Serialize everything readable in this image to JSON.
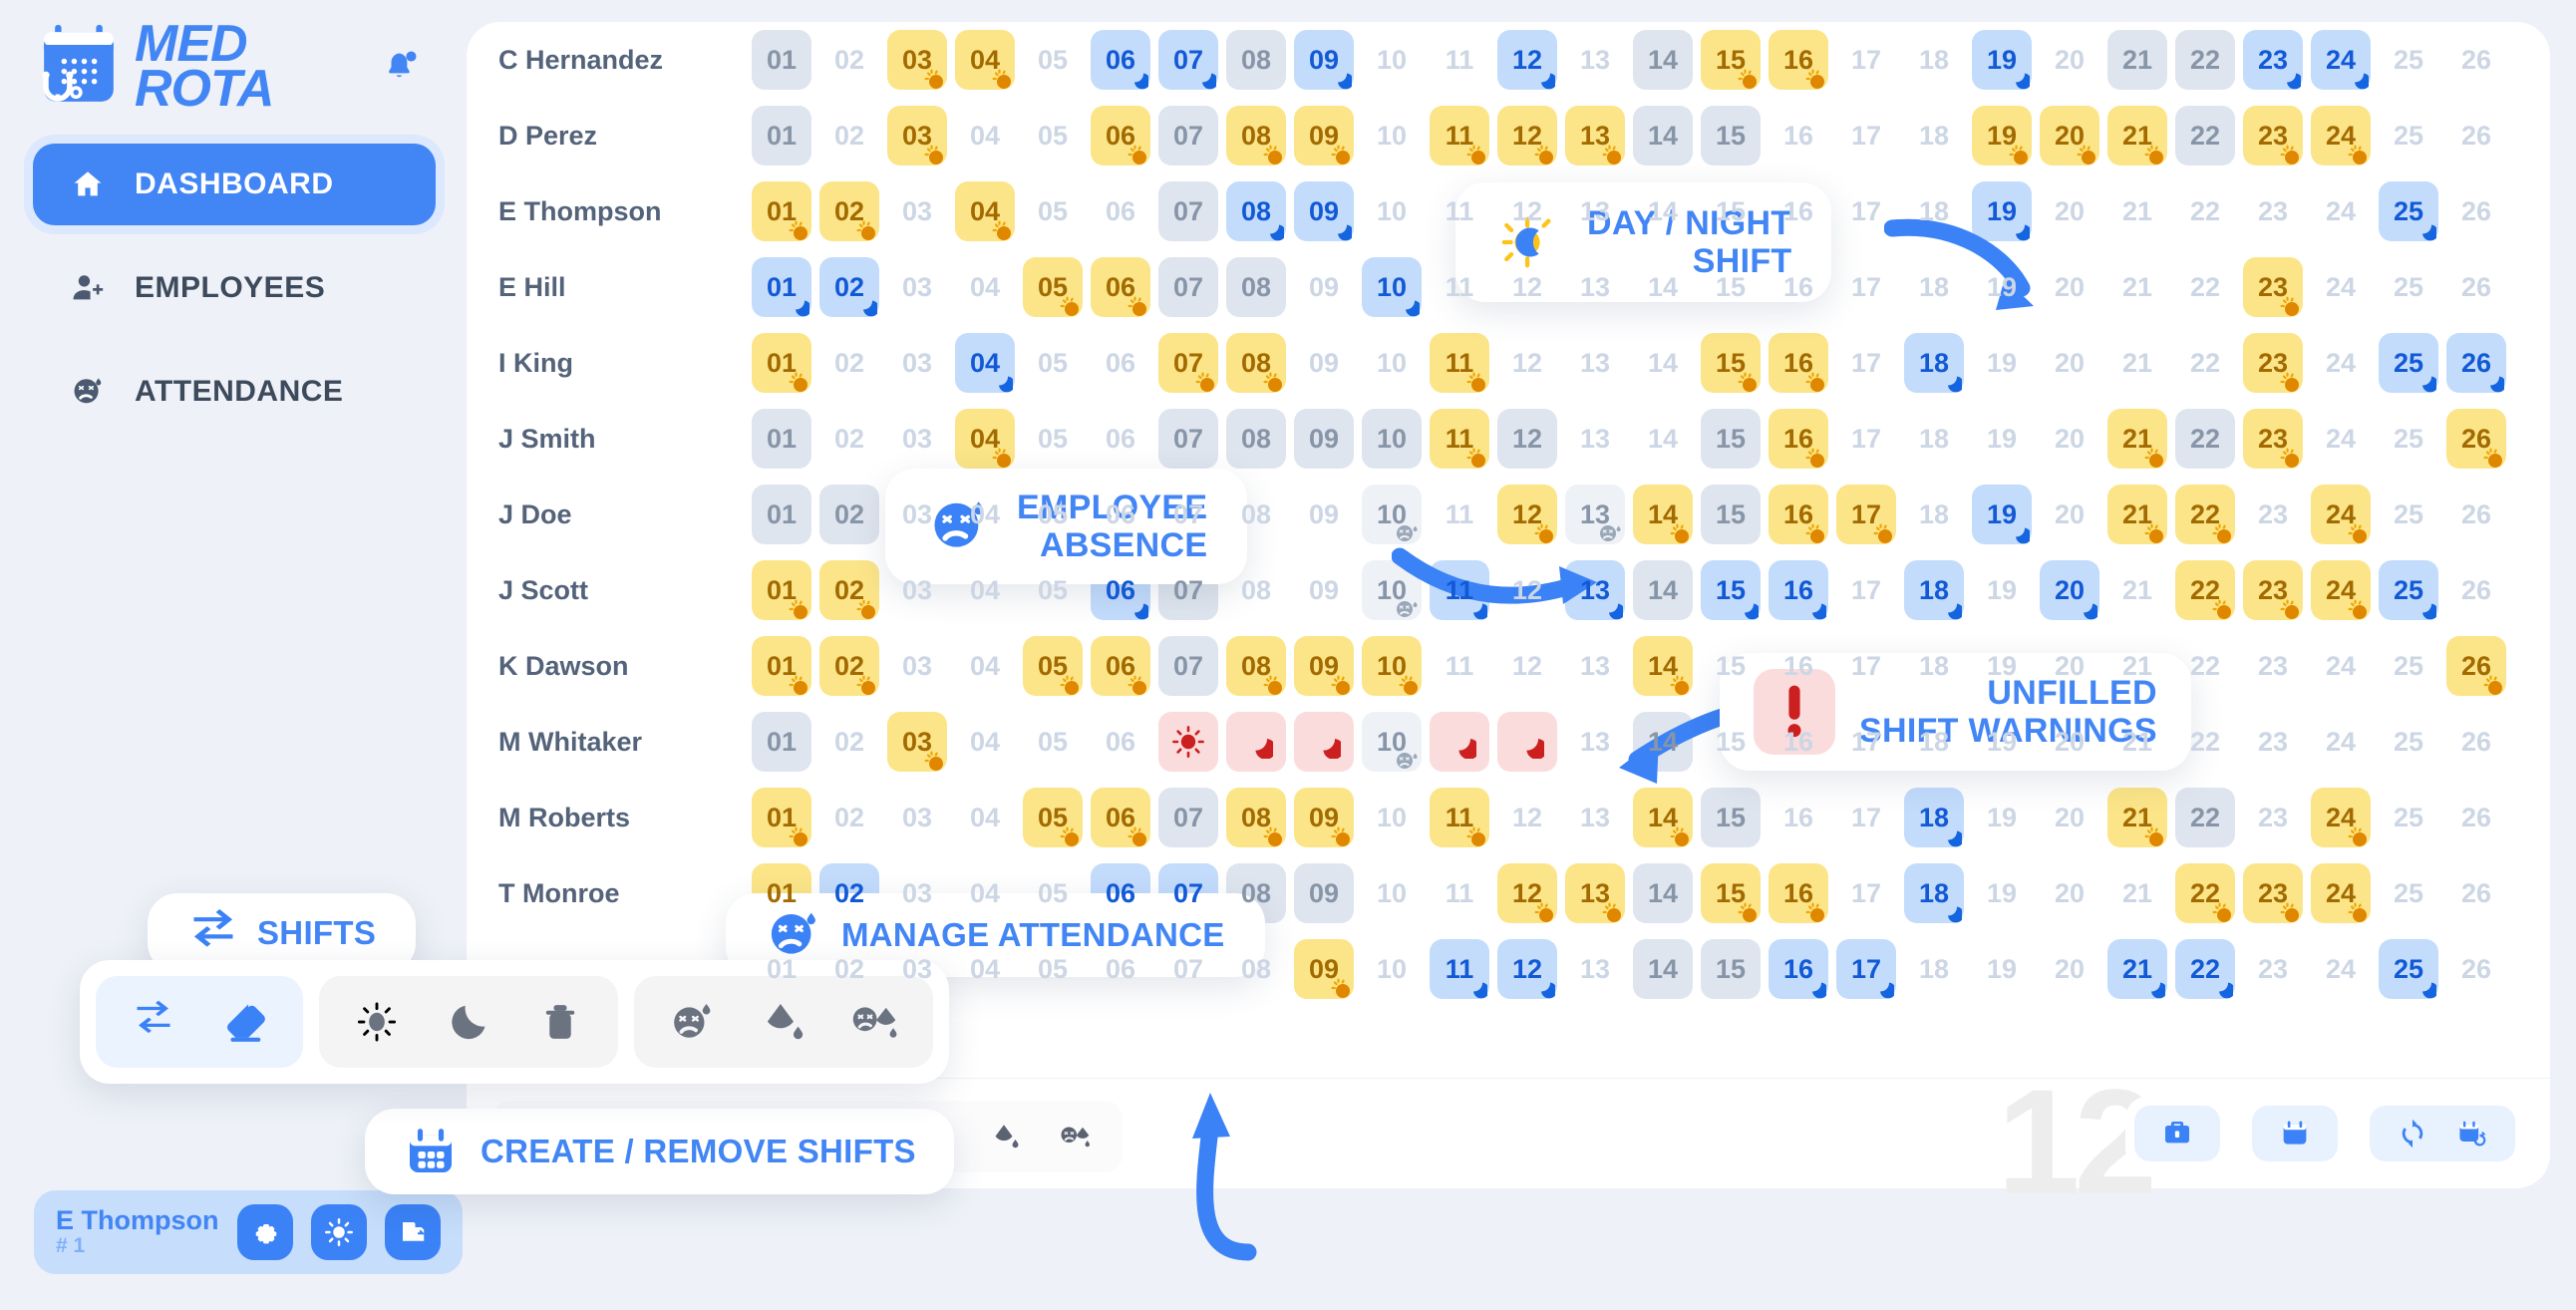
{
  "brand": {
    "line1": "MED",
    "line2": "ROTA",
    "logo_icon": "calendar-stethoscope-icon",
    "bell_icon": "bell-notification-icon",
    "accent": "#4285f4"
  },
  "sidebar": {
    "items": [
      {
        "label": "DASHBOARD",
        "icon": "home-icon",
        "active": true
      },
      {
        "label": "EMPLOYEES",
        "icon": "user-add-icon",
        "active": false
      },
      {
        "label": "ATTENDANCE",
        "icon": "sick-face-icon",
        "active": false
      }
    ]
  },
  "user_card": {
    "name": "E Thompson",
    "number": "# 1",
    "buttons": [
      {
        "icon": "gear-icon",
        "name": "settings"
      },
      {
        "icon": "sun-icon",
        "name": "day-shift"
      },
      {
        "icon": "save-icon",
        "name": "save"
      }
    ]
  },
  "schedule": {
    "days": [
      "01",
      "02",
      "03",
      "04",
      "05",
      "06",
      "07",
      "08",
      "09",
      "10",
      "11",
      "12",
      "13",
      "14",
      "15",
      "16",
      "17",
      "18",
      "19",
      "20",
      "21",
      "22",
      "23",
      "24",
      "25",
      "26"
    ],
    "legend": {
      "day": "#fce588",
      "night": "#c3dcfc",
      "gray": "#dfe5ee",
      "unfilled": "#fbdcdc",
      "absent": "#eef2f7"
    },
    "rows": [
      {
        "name": "C Hernandez",
        "cells": [
          "gray",
          "none",
          "day",
          "day",
          "none",
          "night",
          "night",
          "gray",
          "night",
          "none",
          "none",
          "night",
          "none",
          "gray",
          "day",
          "day",
          "none",
          "none",
          "night",
          "none",
          "gray",
          "gray",
          "night",
          "night",
          "none",
          "none"
        ]
      },
      {
        "name": "D Perez",
        "cells": [
          "gray",
          "none",
          "day",
          "none",
          "none",
          "day",
          "gray",
          "day",
          "day",
          "none",
          "day",
          "day",
          "day",
          "gray",
          "gray",
          "none",
          "none",
          "none",
          "day",
          "day",
          "day",
          "gray",
          "day",
          "day",
          "none",
          "none"
        ]
      },
      {
        "name": "E Thompson",
        "cells": [
          "day",
          "day",
          "none",
          "day",
          "none",
          "none",
          "gray",
          "night",
          "night",
          "none",
          "none",
          "none",
          "none",
          "none",
          "none",
          "none",
          "none",
          "none",
          "night",
          "none",
          "none",
          "none",
          "none",
          "none",
          "night",
          "none"
        ]
      },
      {
        "name": "E Hill",
        "cells": [
          "night",
          "night",
          "none",
          "none",
          "day",
          "day",
          "gray",
          "gray",
          "none",
          "night",
          "none",
          "none",
          "none",
          "none",
          "none",
          "none",
          "none",
          "none",
          "none",
          "none",
          "none",
          "none",
          "day",
          "none",
          "none",
          "none"
        ]
      },
      {
        "name": "I King",
        "cells": [
          "day",
          "none",
          "none",
          "night",
          "none",
          "none",
          "day",
          "day",
          "none",
          "none",
          "day",
          "none",
          "none",
          "none",
          "day",
          "day",
          "none",
          "night",
          "none",
          "none",
          "none",
          "none",
          "day",
          "none",
          "night",
          "night"
        ]
      },
      {
        "name": "J Smith",
        "cells": [
          "gray",
          "none",
          "none",
          "day",
          "none",
          "none",
          "gray",
          "gray",
          "gray",
          "gray",
          "day",
          "gray",
          "none",
          "none",
          "gray",
          "day",
          "none",
          "none",
          "none",
          "none",
          "day",
          "gray",
          "day",
          "none",
          "none",
          "day"
        ]
      },
      {
        "name": "J Doe",
        "cells": [
          "gray",
          "gray",
          "none",
          "none",
          "none",
          "none",
          "none",
          "none",
          "none",
          "absent",
          "none",
          "day",
          "absent",
          "day",
          "gray",
          "day",
          "day",
          "none",
          "night",
          "none",
          "day",
          "day",
          "none",
          "day",
          "none",
          "none"
        ]
      },
      {
        "name": "J Scott",
        "cells": [
          "day",
          "day",
          "none",
          "none",
          "none",
          "night",
          "gray",
          "none",
          "none",
          "absent",
          "night",
          "none",
          "night",
          "gray",
          "night",
          "night",
          "none",
          "night",
          "none",
          "night",
          "none",
          "day",
          "day",
          "day",
          "night",
          "none"
        ]
      },
      {
        "name": "K Dawson",
        "cells": [
          "day",
          "day",
          "none",
          "none",
          "day",
          "day",
          "gray",
          "day",
          "day",
          "day",
          "none",
          "none",
          "none",
          "day",
          "none",
          "none",
          "none",
          "none",
          "none",
          "none",
          "none",
          "none",
          "none",
          "none",
          "none",
          "day"
        ]
      },
      {
        "name": "M Whitaker",
        "cells": [
          "gray",
          "none",
          "day",
          "none",
          "none",
          "none",
          "unfilled-day",
          "unfilled-night",
          "unfilled-night",
          "absent",
          "unfilled-night",
          "unfilled-night",
          "none",
          "gray",
          "none",
          "none",
          "none",
          "none",
          "none",
          "none",
          "none",
          "none",
          "none",
          "none",
          "none",
          "none"
        ]
      },
      {
        "name": "M Roberts",
        "cells": [
          "day",
          "none",
          "none",
          "none",
          "day",
          "day",
          "gray",
          "day",
          "day",
          "none",
          "day",
          "none",
          "none",
          "day",
          "gray",
          "none",
          "none",
          "night",
          "none",
          "none",
          "day",
          "gray",
          "none",
          "day",
          "none",
          "none"
        ]
      },
      {
        "name": "T Monroe",
        "cells": [
          "day",
          "night",
          "none",
          "none",
          "none",
          "night",
          "night",
          "gray",
          "gray",
          "none",
          "none",
          "day",
          "day",
          "gray",
          "day",
          "day",
          "none",
          "night",
          "none",
          "none",
          "none",
          "day",
          "day",
          "day",
          "none",
          "none"
        ]
      },
      {
        "name": "",
        "cells": [
          "none",
          "none",
          "none",
          "none",
          "none",
          "none",
          "none",
          "none",
          "day",
          "none",
          "night",
          "night",
          "none",
          "gray",
          "gray",
          "night",
          "night",
          "none",
          "none",
          "none",
          "night",
          "night",
          "none",
          "none",
          "night",
          "none"
        ]
      }
    ],
    "unfilled_icons": {
      "day": "sun-icon",
      "night": "moon-icon"
    },
    "badge_icons": {
      "day": "sun-icon",
      "night": "moon-icon",
      "absent": "sick-face-icon"
    }
  },
  "callouts": [
    {
      "id": "daynight",
      "icon": "sun-moon-icon",
      "text": "DAY / NIGHT\nSHIFT"
    },
    {
      "id": "absence",
      "icon": "sick-face-icon",
      "text": "EMPLOYEE\nABSENCE"
    },
    {
      "id": "unfilled",
      "icon": "exclamation-icon",
      "text": "UNFILLED\nSHIFT WARNINGS"
    },
    {
      "id": "shifts",
      "icon": "swap-arrows-icon",
      "text": "SHIFTS"
    },
    {
      "id": "create",
      "icon": "calendar-grid-icon",
      "text": "CREATE / REMOVE SHIFTS"
    },
    {
      "id": "manage",
      "icon": "sick-face-icon",
      "text": "MANAGE ATTENDANCE"
    }
  ],
  "palette": {
    "groups": [
      {
        "name": "shifts",
        "style": "blue",
        "buttons": [
          {
            "icon": "swap-arrows-icon",
            "name": "swap-shift"
          },
          {
            "icon": "eraser-icon",
            "name": "erase-shift"
          }
        ]
      },
      {
        "name": "create-remove",
        "style": "gray",
        "buttons": [
          {
            "icon": "sun-icon",
            "name": "add-day-shift"
          },
          {
            "icon": "moon-icon",
            "name": "add-night-shift"
          },
          {
            "icon": "trash-icon",
            "name": "remove-shift"
          }
        ]
      },
      {
        "name": "attendance",
        "style": "gray",
        "buttons": [
          {
            "icon": "sick-face-icon",
            "name": "mark-sick"
          },
          {
            "icon": "drop-icon",
            "name": "mark-leave"
          },
          {
            "icon": "sick-drop-icon",
            "name": "mark-sick-leave"
          }
        ]
      }
    ]
  },
  "mini_toolbar": [
    {
      "icon": "swap-arrows-icon",
      "name": "swap-shift"
    },
    {
      "icon": "eraser-icon",
      "name": "erase-shift"
    },
    {
      "icon": "sun-icon",
      "name": "add-day-shift"
    },
    {
      "icon": "moon-icon",
      "name": "add-night-shift"
    },
    {
      "icon": "trash-icon",
      "name": "remove-shift"
    },
    {
      "icon": "sick-face-icon",
      "name": "mark-sick"
    },
    {
      "icon": "drop-icon",
      "name": "mark-leave"
    },
    {
      "icon": "sick-drop-icon",
      "name": "mark-sick-leave"
    }
  ],
  "watermark": "12",
  "right_buttons": [
    {
      "icon": "toolbox-icon",
      "name": "toolbox"
    },
    {
      "icon": "calendar-icon",
      "name": "calendar"
    },
    {
      "icon": "refresh-icon",
      "name": "refresh"
    },
    {
      "icon": "calendar-sync-icon",
      "name": "calendar-sync"
    }
  ]
}
